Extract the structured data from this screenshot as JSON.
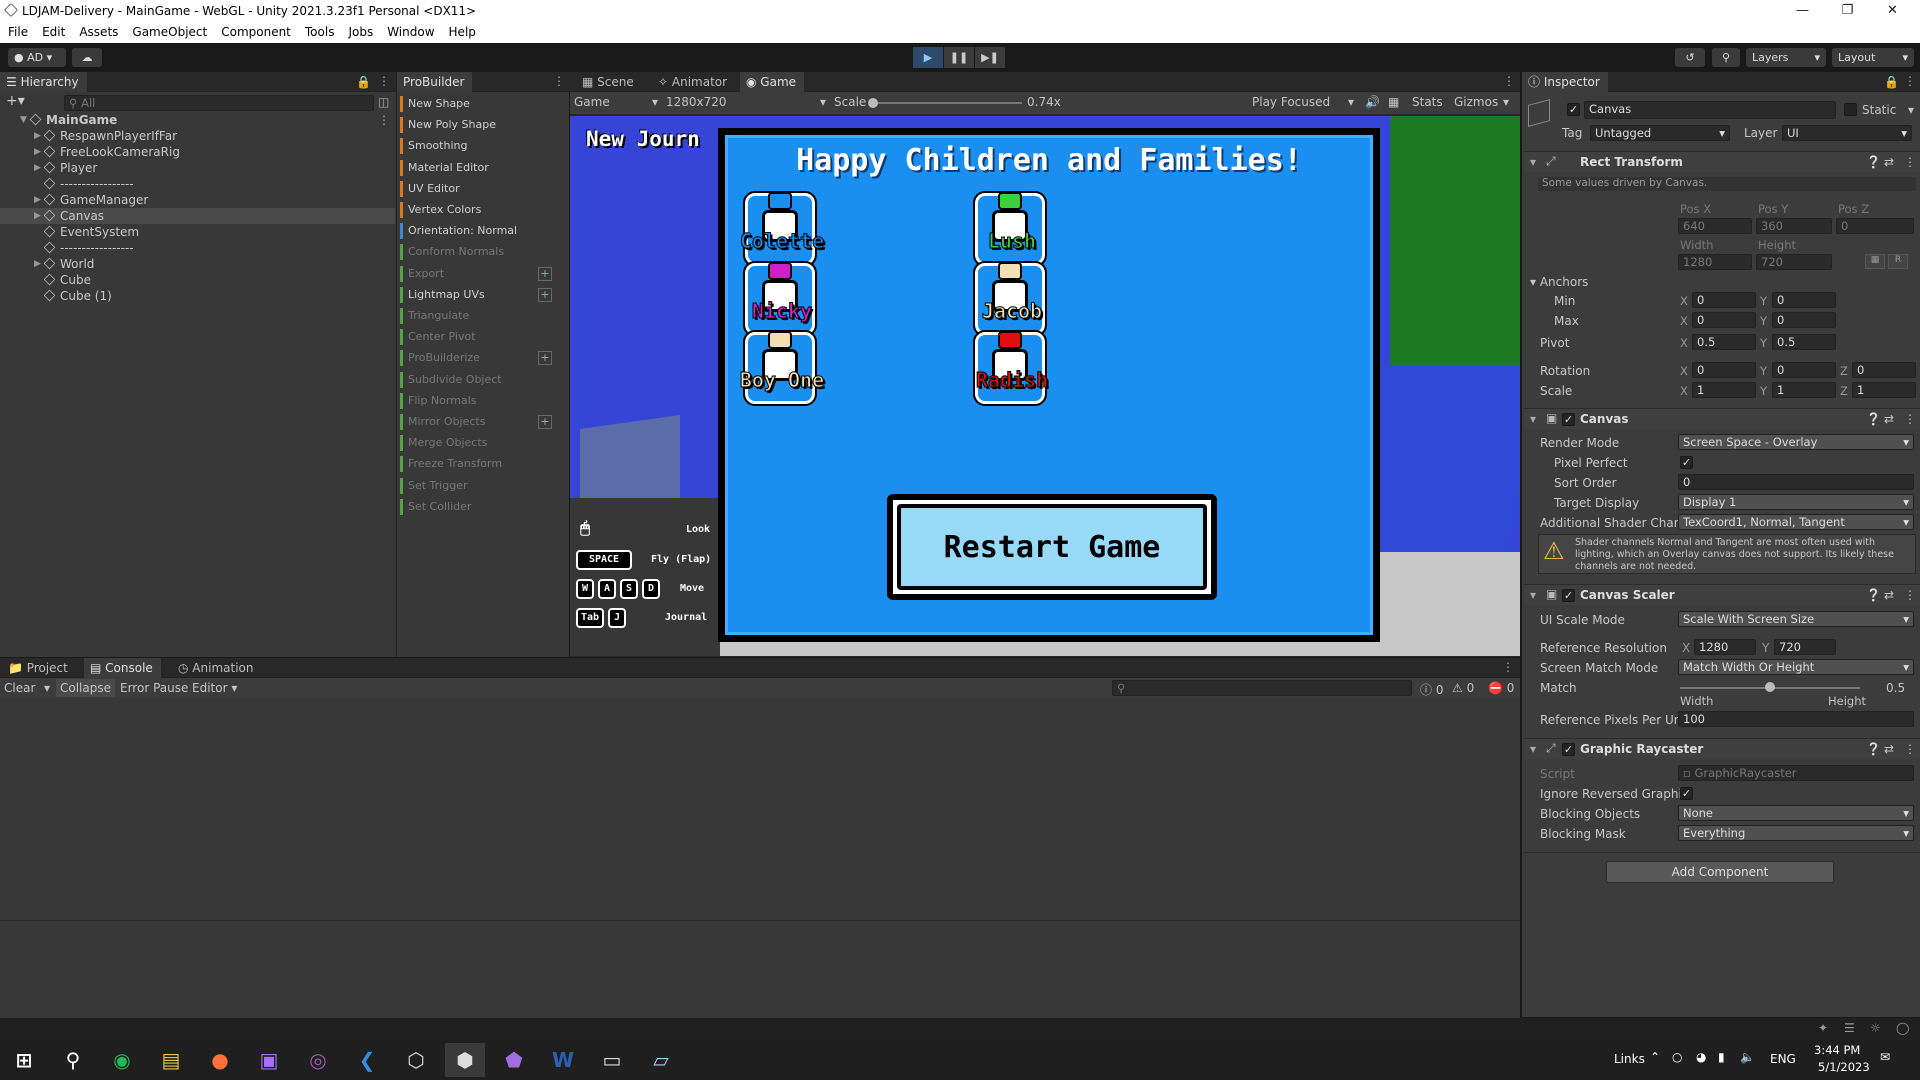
{
  "window": {
    "title": "LDJAM-Delivery - MainGame - WebGL - Unity 2021.3.23f1 Personal <DX11>"
  },
  "menu": [
    "File",
    "Edit",
    "Assets",
    "GameObject",
    "Component",
    "Tools",
    "Jobs",
    "Window",
    "Help"
  ],
  "toolbar": {
    "account": "AD",
    "layers": "Layers",
    "layout": "Layout"
  },
  "hierarchy": {
    "tab": "Hierarchy",
    "search_placeholder": "All",
    "items": [
      {
        "label": "MainGame",
        "depth": 0,
        "expander": "open",
        "kind": "scene"
      },
      {
        "label": "RespawnPlayerIfFar",
        "depth": 1,
        "expander": "closed"
      },
      {
        "label": "FreeLookCameraRig",
        "depth": 1,
        "expander": "closed"
      },
      {
        "label": "Player",
        "depth": 1,
        "expander": "closed"
      },
      {
        "label": "-----------------",
        "depth": 1,
        "expander": "none"
      },
      {
        "label": "GameManager",
        "depth": 1,
        "expander": "closed"
      },
      {
        "label": "Canvas",
        "depth": 1,
        "expander": "closed",
        "selected": true
      },
      {
        "label": "EventSystem",
        "depth": 1,
        "expander": "none"
      },
      {
        "label": "-----------------",
        "depth": 1,
        "expander": "none"
      },
      {
        "label": "World",
        "depth": 1,
        "expander": "closed"
      },
      {
        "label": "Cube",
        "depth": 1,
        "expander": "none"
      },
      {
        "label": "Cube (1)",
        "depth": 1,
        "expander": "none"
      }
    ]
  },
  "probuilder": {
    "tab": "ProBuilder",
    "items": [
      {
        "label": "New Shape",
        "color": "#d57a2a",
        "enabled": true
      },
      {
        "label": "New Poly Shape",
        "color": "#d57a2a",
        "enabled": true
      },
      {
        "label": "Smoothing",
        "color": "#d57a2a",
        "enabled": true
      },
      {
        "label": "Material Editor",
        "color": "#d57a2a",
        "enabled": true
      },
      {
        "label": "UV Editor",
        "color": "#d57a2a",
        "enabled": true
      },
      {
        "label": "Vertex Colors",
        "color": "#d57a2a",
        "enabled": true
      },
      {
        "label": "Orientation: Normal",
        "color": "#3f88c5",
        "enabled": true
      },
      {
        "label": "Conform Normals",
        "color": "#5aa04a",
        "enabled": false
      },
      {
        "label": "Export",
        "color": "#5aa04a",
        "enabled": false,
        "plus": true
      },
      {
        "label": "Lightmap UVs",
        "color": "#5aa04a",
        "enabled": true,
        "plus": true
      },
      {
        "label": "Triangulate",
        "color": "#5aa04a",
        "enabled": false
      },
      {
        "label": "Center Pivot",
        "color": "#5aa04a",
        "enabled": false
      },
      {
        "label": "ProBuilderize",
        "color": "#5aa04a",
        "enabled": false,
        "plus": true
      },
      {
        "label": "Subdivide Object",
        "color": "#5aa04a",
        "enabled": false
      },
      {
        "label": "Flip Normals",
        "color": "#5aa04a",
        "enabled": false
      },
      {
        "label": "Mirror Objects",
        "color": "#5aa04a",
        "enabled": false,
        "plus": true
      },
      {
        "label": "Merge Objects",
        "color": "#5aa04a",
        "enabled": false
      },
      {
        "label": "Freeze Transform",
        "color": "#5aa04a",
        "enabled": false
      },
      {
        "label": "Set Trigger",
        "color": "#5aa04a",
        "enabled": false
      },
      {
        "label": "Set Collider",
        "color": "#5aa04a",
        "enabled": false
      }
    ]
  },
  "game_view": {
    "tabs": [
      "Scene",
      "Animator",
      "Game"
    ],
    "display": "Game",
    "resolution": "1280x720",
    "scale_label": "Scale",
    "scale_value": "0.74x",
    "play_mode": "Play Focused",
    "stats": "Stats",
    "gizmos": "Gizmos",
    "journal_text": "New Journ",
    "dialog_title": "Happy Children and Families!",
    "characters": [
      {
        "name": "Colette",
        "hat": "#1a8ff0",
        "text": "#1a8ff0"
      },
      {
        "name": "Lush",
        "hat": "#3ed13e",
        "text": "#3ed13e"
      },
      {
        "name": "Nicky",
        "hat": "#d11ec9",
        "text": "#e11ed9"
      },
      {
        "name": "Jacob",
        "hat": "#f3dfb2",
        "text": "#f3dfb2"
      },
      {
        "name": "Boy One",
        "hat": "#f3dfb2",
        "text": "#f3dfb2"
      },
      {
        "name": "Radish",
        "hat": "#e01010",
        "text": "#e01010"
      }
    ],
    "restart_label": "Restart Game",
    "controls": [
      {
        "keys": [
          "🖱"
        ],
        "label": "Look"
      },
      {
        "keys": [
          "SPACE"
        ],
        "label": "Fly (Flap)"
      },
      {
        "keys": [
          "W",
          "A",
          "S",
          "D"
        ],
        "label": "Move"
      },
      {
        "keys": [
          "Tab",
          "J"
        ],
        "label": "Journal"
      }
    ]
  },
  "console": {
    "tabs": [
      "Project",
      "Console",
      "Animation"
    ],
    "buttons": [
      "Clear",
      "Collapse",
      "Error Pause",
      "Editor"
    ],
    "counts": {
      "info": "0",
      "warn": "0",
      "error": "0"
    }
  },
  "inspector": {
    "tab": "Inspector",
    "object_name": "Canvas",
    "static": "Static",
    "tag_label": "Tag",
    "tag": "Untagged",
    "layer_label": "Layer",
    "layer": "UI",
    "rect_transform": {
      "title": "Rect Transform",
      "note": "Some values driven by Canvas.",
      "pos_x_label": "Pos X",
      "pos_y_label": "Pos Y",
      "pos_z_label": "Pos Z",
      "pos_x": "640",
      "pos_y": "360",
      "pos_z": "0",
      "width_label": "Width",
      "height_label": "Height",
      "width": "1280",
      "height": "720",
      "anchors": "Anchors",
      "min": "Min",
      "max": "Max",
      "min_x": "0",
      "min_y": "0",
      "max_x": "0",
      "max_y": "0",
      "pivot": "Pivot",
      "pivot_x": "0.5",
      "pivot_y": "0.5",
      "rotation": "Rotation",
      "rot_x": "0",
      "rot_y": "0",
      "rot_z": "0",
      "scale": "Scale",
      "scale_x": "1",
      "scale_y": "1",
      "scale_z": "1",
      "x": "X",
      "y": "Y",
      "z": "Z",
      "r": "R"
    },
    "canvas": {
      "title": "Canvas",
      "render_mode_label": "Render Mode",
      "render_mode": "Screen Space - Overlay",
      "pixel_perfect_label": "Pixel Perfect",
      "sort_order_label": "Sort Order",
      "sort_order": "0",
      "target_display_label": "Target Display",
      "target_display": "Display 1",
      "shader_label": "Additional Shader Chann",
      "shader": "TexCoord1, Normal, Tangent",
      "warning": "Shader channels Normal and Tangent are most often used with lighting, which an Overlay canvas does not support. Its likely these channels are not needed."
    },
    "scaler": {
      "title": "Canvas Scaler",
      "mode_label": "UI Scale Mode",
      "mode": "Scale With Screen Size",
      "ref_label": "Reference Resolution",
      "ref_x": "1280",
      "ref_y": "720",
      "match_mode_label": "Screen Match Mode",
      "match_mode": "Match Width Or Height",
      "match_label": "Match",
      "match_value": "0.5",
      "match_fraction": 0.5,
      "width_label": "Width",
      "height_label": "Height",
      "ppu_label": "Reference Pixels Per Uni",
      "ppu": "100"
    },
    "raycaster": {
      "title": "Graphic Raycaster",
      "script_label": "Script",
      "script": "GraphicRaycaster",
      "ignore_label": "Ignore Reversed Graphic",
      "blocking_label": "Blocking Objects",
      "blocking": "None",
      "mask_label": "Blocking Mask",
      "mask": "Everything"
    },
    "add_component": "Add Component"
  },
  "taskbar": {
    "links": "Links",
    "lang": "ENG",
    "time": "3:44 PM",
    "date": "5/1/2023"
  },
  "colors": {
    "game_bg": "#1a8ff0",
    "sky": "#3545d6",
    "accent": "#3d75c5"
  }
}
